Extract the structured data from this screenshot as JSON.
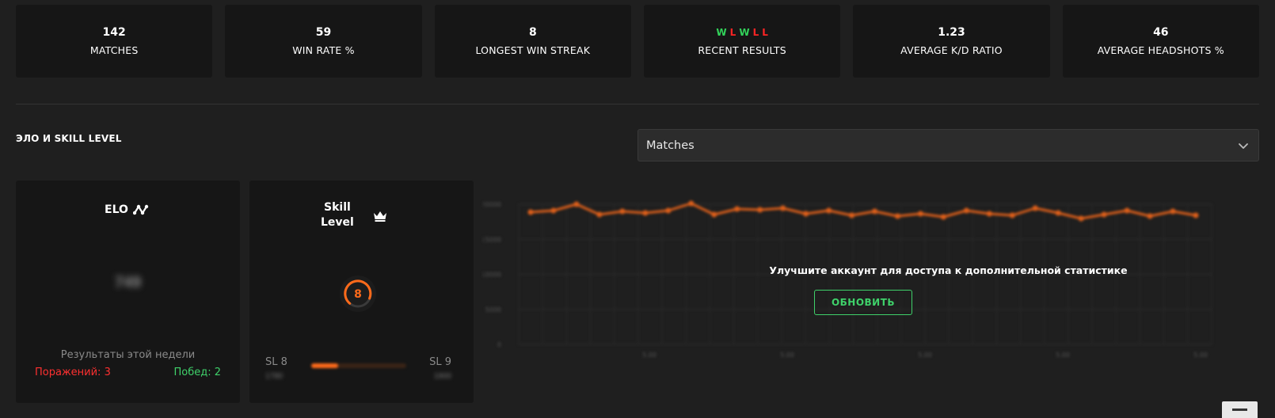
{
  "stats": [
    {
      "value": "142",
      "label": "MATCHES"
    },
    {
      "value": "59",
      "label": "WIN RATE %"
    },
    {
      "value": "8",
      "label": "LONGEST WIN STREAK"
    },
    {
      "value": "",
      "label": "RECENT RESULTS"
    },
    {
      "value": "1.23",
      "label": "AVERAGE K/D RATIO"
    },
    {
      "value": "46",
      "label": "AVERAGE HEADSHOTS %"
    }
  ],
  "recent_results": [
    "W",
    "L",
    "W",
    "L",
    "L"
  ],
  "colors": {
    "win": "#32d35a",
    "loss": "#ff2424",
    "accent": "#ff6a1a",
    "upgrade": "#3fd16a"
  },
  "section": {
    "title": "ЭЛО И SKILL LEVEL"
  },
  "select": {
    "value": "Matches",
    "icon": "chevron-down-icon"
  },
  "elo": {
    "title": "ELO",
    "icon": "trend-line-icon",
    "value": "749",
    "week_label": "Результаты этой недели",
    "losses": "Поражений: 3",
    "wins": "Побед: 2"
  },
  "skill": {
    "title_line1": "Skill",
    "title_line2": "Level",
    "icon": "crown-icon",
    "level": "8",
    "left_label": "SL 8",
    "right_label": "SL 9",
    "left_elo": "1780",
    "right_elo": "1900",
    "progress": 0.28
  },
  "chart": {
    "y_ticks": [
      "20000",
      "15000",
      "10000",
      "5000",
      "0"
    ],
    "x_ticks": [
      "5.00",
      "5.00",
      "5.00",
      "5.00",
      "5.00"
    ],
    "blurred": true
  },
  "upgrade": {
    "text": "Улучшите аккаунт для доступа к дополнительной статистике",
    "button": "ОБНОВИТЬ"
  }
}
